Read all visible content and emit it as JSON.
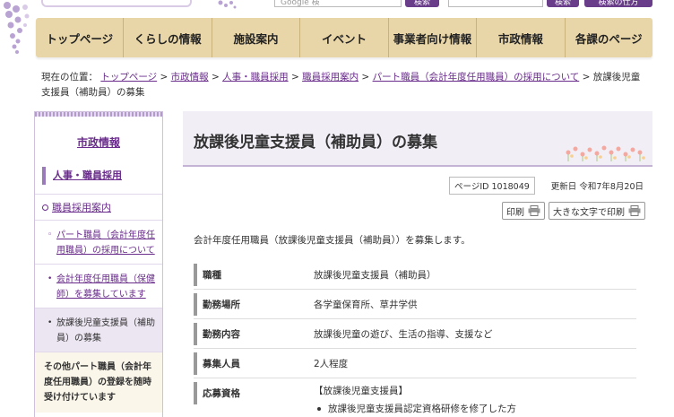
{
  "header": {
    "search_placeholder": "Google 検",
    "search_button": "検索",
    "site_search_button": "検索",
    "detail_search_button": "検索の仕方"
  },
  "global_nav": [
    "トップページ",
    "くらしの情報",
    "施設案内",
    "イベント",
    "事業者向け情報",
    "市政情報",
    "各課のページ"
  ],
  "breadcrumb": {
    "prefix": "現在の位置：",
    "links": [
      "トップページ",
      "市政情報",
      "人事・職員採用",
      "職員採用案内",
      "パート職員（会計年度任用職員）の採用について"
    ],
    "separator": " > ",
    "current": "放課後児童支援員（補助員）の募集"
  },
  "sidebar": {
    "heading": "市政情報",
    "subheading": "人事・職員採用",
    "recruit_link": "職員採用案内",
    "items": [
      {
        "label": "パート職員（会計年度任用職員）の採用について",
        "mark": "◦",
        "current": false
      },
      {
        "label": "会計年度任用職員（保健師）を募集しています",
        "mark": "•",
        "current": false
      },
      {
        "label": "放課後児童支援員（補助員）の募集",
        "mark": "•",
        "current": true
      }
    ],
    "other": "その他パート職員（会計年度任用職員）の登録を随時受け付けています"
  },
  "main": {
    "title": "放課後児童支援員（補助員）の募集",
    "page_id": "ページID 1018049",
    "updated": "更新日 令和7年8月20日",
    "print_label": "印刷",
    "large_print_label": "大きな文字で印刷",
    "intro": "会計年度任用職員（放課後児童支援員（補助員））を募集します。",
    "table": [
      {
        "key": "職種",
        "value": "放課後児童支援員（補助員）"
      },
      {
        "key": "勤務場所",
        "value": "各学童保育所、草井学供"
      },
      {
        "key": "勤務内容",
        "value": "放課後児童の遊び、生活の指導、支援など"
      },
      {
        "key": "募集人員",
        "value": "2人程度"
      },
      {
        "key": "応募資格",
        "value": "【放課後児童支援員】",
        "bullet": "放課後児童支援員認定資格研修を修了した方"
      }
    ]
  },
  "colors": {
    "nav_bg": "#e9d6a8",
    "accent_purple": "#6a2d8c",
    "button_purple": "#6a3d8a",
    "title_bg": "#f2eef6"
  }
}
